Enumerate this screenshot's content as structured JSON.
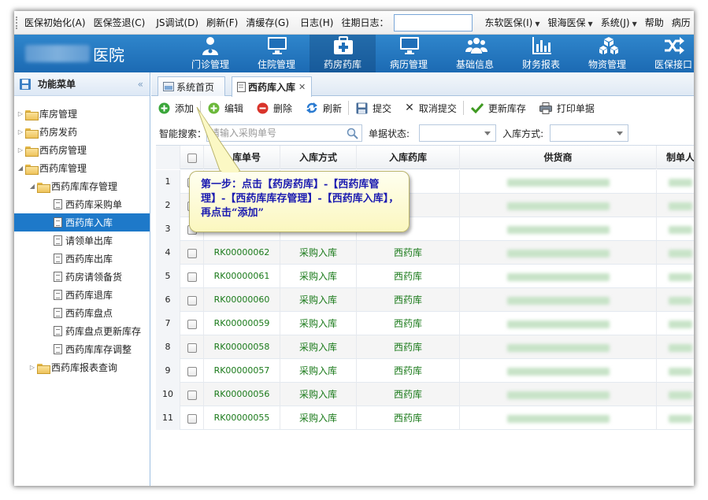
{
  "menubar": {
    "items": [
      {
        "label": "医保初始化(A)"
      },
      {
        "label": "医保签退(C)"
      },
      {
        "label": "JS调试(D)"
      },
      {
        "label": "刷新(F)"
      },
      {
        "label": "清缓存(G)"
      },
      {
        "label": "日志(H)"
      },
      {
        "label": "往期日志："
      },
      {
        "label": "东软医保(I)"
      },
      {
        "label": "银海医保"
      },
      {
        "label": "系统(J)"
      },
      {
        "label": "帮助"
      },
      {
        "label": "病历"
      }
    ],
    "log_input_value": ""
  },
  "header": {
    "hospital_name": "医院",
    "nav": [
      {
        "label": "门诊管理",
        "icon": "doctor-icon"
      },
      {
        "label": "住院管理",
        "icon": "monitor-icon"
      },
      {
        "label": "药房药库",
        "icon": "medkit-icon"
      },
      {
        "label": "病历管理",
        "icon": "monitor-icon"
      },
      {
        "label": "基础信息",
        "icon": "users-icon"
      },
      {
        "label": "财务报表",
        "icon": "bar-chart-icon"
      },
      {
        "label": "物资管理",
        "icon": "cubes-icon"
      },
      {
        "label": "医保接口",
        "icon": "shuffle-icon"
      }
    ]
  },
  "sidebar": {
    "title": "功能菜单",
    "collapse_glyph": "«",
    "items": [
      {
        "label": "库房管理"
      },
      {
        "label": "药房发药"
      },
      {
        "label": "西药房管理"
      },
      {
        "label": "西药库管理"
      },
      {
        "label": "西药库库存管理"
      },
      {
        "label": "西药库采购单"
      },
      {
        "label": "西药库入库"
      },
      {
        "label": "请领单出库"
      },
      {
        "label": "西药库出库"
      },
      {
        "label": "药房请领备货"
      },
      {
        "label": "西药库退库"
      },
      {
        "label": "西药库盘点"
      },
      {
        "label": "药库盘点更新库存"
      },
      {
        "label": "西药库库存调整"
      },
      {
        "label": "西药库报表查询"
      }
    ]
  },
  "tabs": [
    {
      "label": "系统首页"
    },
    {
      "label": "西药库入库"
    }
  ],
  "toolbar": {
    "add": "添加",
    "edit": "编辑",
    "delete": "删除",
    "refresh": "刷新",
    "submit": "提交",
    "cancel_submit": "取消提交",
    "update_stock": "更新库存",
    "print": "打印单据"
  },
  "search": {
    "smart_label": "智能搜索：",
    "smart_placeholder": "请输入采购单号",
    "status_label": "单据状态:",
    "status_value": "",
    "mode_label": "入库方式:",
    "mode_value": ""
  },
  "table": {
    "headers": {
      "id": "入库单号",
      "mode": "入库方式",
      "store": "入库药库",
      "supplier": "供货商",
      "maker": "制单人"
    },
    "rows": [
      {
        "no": "1",
        "id": "",
        "mode": "",
        "store": ""
      },
      {
        "no": "2",
        "id": "",
        "mode": "",
        "store": ""
      },
      {
        "no": "3",
        "id": "",
        "mode": "",
        "store": ""
      },
      {
        "no": "4",
        "id": "RK00000062",
        "mode": "采购入库",
        "store": "西药库"
      },
      {
        "no": "5",
        "id": "RK00000061",
        "mode": "采购入库",
        "store": "西药库"
      },
      {
        "no": "6",
        "id": "RK00000060",
        "mode": "采购入库",
        "store": "西药库"
      },
      {
        "no": "7",
        "id": "RK00000059",
        "mode": "采购入库",
        "store": "西药库"
      },
      {
        "no": "8",
        "id": "RK00000058",
        "mode": "采购入库",
        "store": "西药库"
      },
      {
        "no": "9",
        "id": "RK00000057",
        "mode": "采购入库",
        "store": "西药库"
      },
      {
        "no": "10",
        "id": "RK00000056",
        "mode": "采购入库",
        "store": "西药库"
      },
      {
        "no": "11",
        "id": "RK00000055",
        "mode": "采购入库",
        "store": "西药库"
      }
    ]
  },
  "callout": {
    "text": "第一步：点击【药房药库】-【西药库管理】-【西药库库存管理】-【西药库入库】，再点击“添加”"
  },
  "colors": {
    "header_blue": "#1f6fb8",
    "selected_blue": "#1e79c9",
    "row_text_green": "#1a7a1a",
    "callout_text": "#1a1ab0"
  }
}
